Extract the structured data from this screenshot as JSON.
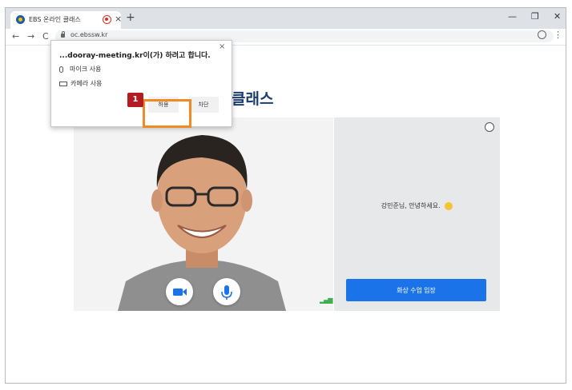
{
  "browser": {
    "tab_title": "EBS 온라인 클래스",
    "tab_close": "×",
    "new_tab": "+",
    "minimize": "—",
    "restore": "❐",
    "close": "✕",
    "back": "←",
    "forward": "→",
    "reload": "C",
    "url": "oc.ebssw.kr",
    "menu": "⋮"
  },
  "page": {
    "brand_visible": "클래스",
    "greeting": "강민준님, 안녕하세요.",
    "enter_button": "화상 수업 입장",
    "signal": "▂▄▆"
  },
  "permission_popup": {
    "title": "...dooray-meeting.kr이(가) 하려고 합니다.",
    "close": "×",
    "mic_label": "마이크 사용",
    "camera_label": "카메라 사용",
    "allow_label": "허용",
    "block_label": "차단"
  },
  "annotation": {
    "step_number": "1",
    "accent_color": "#f08a24",
    "badge_color": "#b31d22"
  },
  "colors": {
    "primary_button": "#1a73e8",
    "brand_text": "#1c3d6e"
  }
}
